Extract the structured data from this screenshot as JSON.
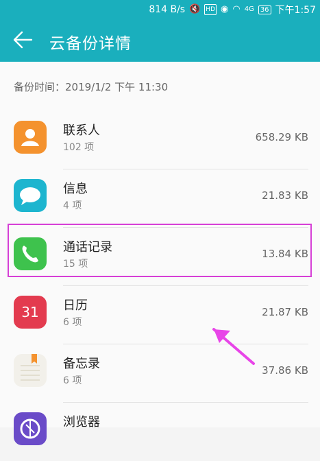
{
  "status_bar": {
    "speed": "814 B/s",
    "signal_label": "4G",
    "battery": "36",
    "time": "下午1:57"
  },
  "app_bar": {
    "title": "云备份详情"
  },
  "backup_time": "备份时间：2019/1/2 下午 11:30",
  "items": [
    {
      "name": "联系人",
      "count": "102 项",
      "size": "658.29 KB",
      "icon": "contacts-icon"
    },
    {
      "name": "信息",
      "count": "4 项",
      "size": "21.83 KB",
      "icon": "messages-icon"
    },
    {
      "name": "通话记录",
      "count": "15 项",
      "size": "13.84 KB",
      "icon": "phone-icon"
    },
    {
      "name": "日历",
      "count": "6 项",
      "size": "21.87 KB",
      "icon": "calendar-icon",
      "icon_text": "31"
    },
    {
      "name": "备忘录",
      "count": "6 项",
      "size": "37.86 KB",
      "icon": "notes-icon"
    },
    {
      "name": "浏览器",
      "count": "",
      "size": "",
      "icon": "browser-icon"
    }
  ],
  "colors": {
    "header": "#1aafbd",
    "highlight": "#d63fd6"
  }
}
